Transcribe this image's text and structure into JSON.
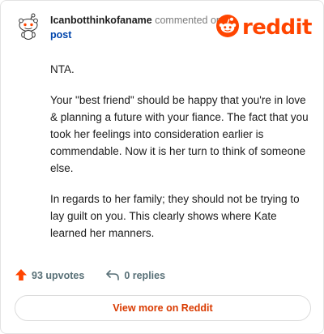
{
  "comment": {
    "username": "Icanbotthinkofaname",
    "action": "commented on",
    "post_link": "post",
    "paragraphs": [
      "NTA.",
      "Your \"best friend\" should be happy that you're in love & planning a future with your fiance. The fact that you took her feelings into consideration earlier is commendable. Now it is her turn to think of someone else.",
      "In regards to her family; they should not be trying to lay guilt on you. This clearly shows where Kate learned her manners."
    ]
  },
  "brand": {
    "name": "reddit",
    "color": "#ff4500"
  },
  "footer": {
    "upvotes": "93 upvotes",
    "replies": "0 replies",
    "upvote_icon": "upvote-arrow-icon",
    "reply_icon": "reply-arrow-icon"
  },
  "cta": {
    "label": "View more on Reddit",
    "color": "#d93a00"
  }
}
